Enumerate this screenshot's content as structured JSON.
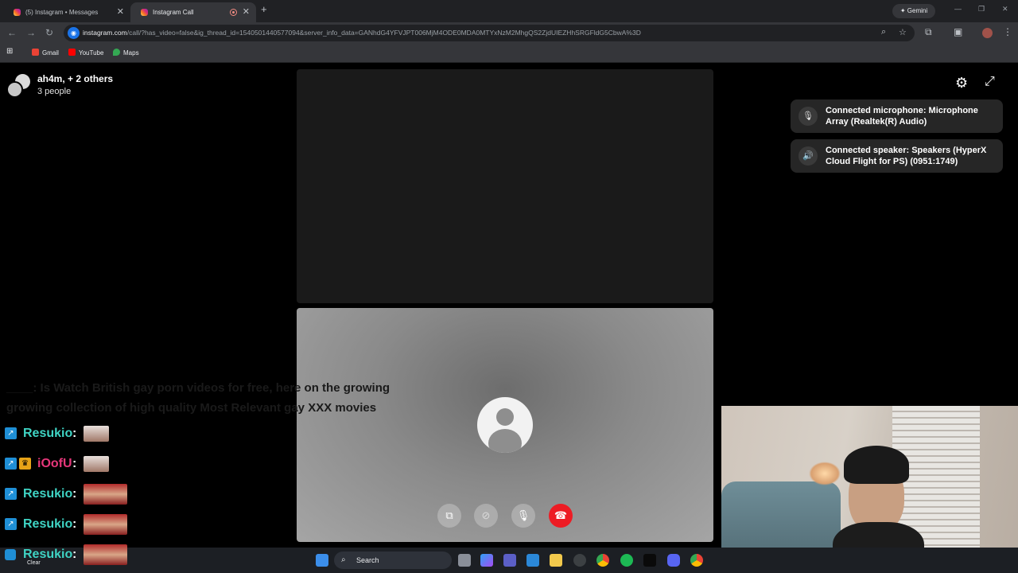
{
  "browser": {
    "tabs": [
      {
        "label": "(5) Instagram • Messages",
        "active": false
      },
      {
        "label": "Instagram Call",
        "active": true
      }
    ],
    "gemini_label": "Gemini",
    "url_host": "instagram.com",
    "url_rest": "/call/?has_video=false&ig_thread_id=1540501440577094&server_info_data=GANhdG4YFVJPT006MjM4ODE0MDA0MTYxNzM2MhgQS2ZjdUIEZHhSRGFldG5CbwA%3D",
    "bookmarks": [
      {
        "label": "Gmail",
        "color": "#ea4335"
      },
      {
        "label": "YouTube",
        "color": "#ff0000"
      },
      {
        "label": "Maps",
        "color": "#34a853"
      }
    ]
  },
  "call": {
    "title": "ah4m, + 2 others",
    "subtitle": "3 people",
    "notifications": [
      {
        "icon": "microphone-icon",
        "text": "Connected microphone: Microphone Array (Realtek(R) Audio)"
      },
      {
        "icon": "speaker-icon",
        "text": "Connected speaker: Speakers (HyperX Cloud Flight for PS) (0951:1749)"
      }
    ],
    "controls": [
      "share-screen",
      "camera-off",
      "microphone",
      "end-call"
    ]
  },
  "overlay": {
    "spam_line1": "____: Is Watch British gay porn videos for free, here on the growing",
    "spam_line2": "growing collection of high quality Most Relevant gay XXX movies",
    "chat": [
      {
        "name": "Resukio",
        "sep": ":",
        "color": "#3fd4c4",
        "crown": false,
        "emote": "small"
      },
      {
        "name": "iOofU",
        "sep": ":",
        "color": "#e6377a",
        "crown": true,
        "emote": "small"
      },
      {
        "name": "Resukio",
        "sep": ":",
        "color": "#3fd4c4",
        "crown": false,
        "emote": "large"
      },
      {
        "name": "Resukio",
        "sep": ":",
        "color": "#3fd4c4",
        "crown": false,
        "emote": "large"
      },
      {
        "name": "Resukio",
        "sep": ":",
        "color": "#3fd4c4",
        "crown": false,
        "emote": "large"
      }
    ]
  },
  "taskbar": {
    "search_label": "Search",
    "clear_label": "Clear"
  }
}
